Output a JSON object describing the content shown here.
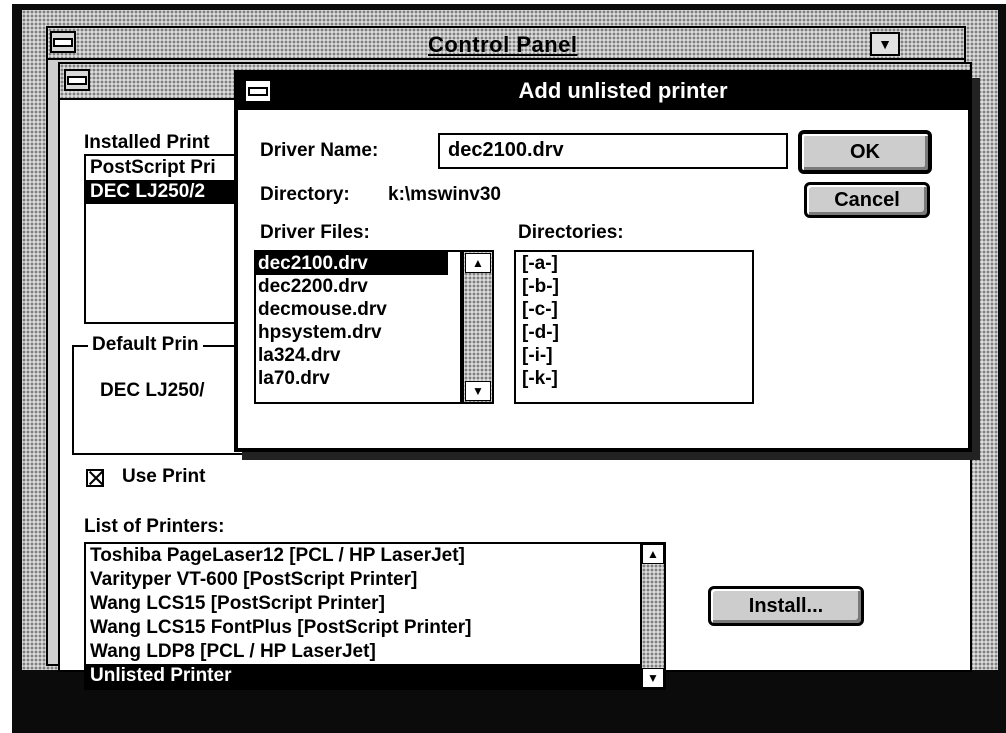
{
  "control_panel": {
    "title": "Control Panel"
  },
  "printers": {
    "installed_label": "Installed Print",
    "installed_items": [
      "PostScript Pri",
      "DEC LJ250/2"
    ],
    "default_label": "Default Prin",
    "default_value": "DEC LJ250/",
    "use_print_label": "Use Print",
    "use_print_checked": true,
    "list_label": "List of Printers:",
    "list_items": [
      "Toshiba PageLaser12 [PCL / HP LaserJet]",
      "Varityper VT-600 [PostScript Printer]",
      "Wang LCS15 [PostScript Printer]",
      "Wang LCS15 FontPlus [PostScript Printer]",
      "Wang LDP8 [PCL / HP LaserJet]",
      "Unlisted Printer"
    ],
    "install_button": "Install..."
  },
  "dialog": {
    "title": "Add unlisted printer",
    "driver_name_label": "Driver Name:",
    "driver_name_value": "dec2100.drv",
    "directory_label": "Directory:",
    "directory_value": "k:\\mswinv30",
    "driver_files_label": "Driver Files:",
    "directories_label": "Directories:",
    "driver_files": [
      "dec2100.drv",
      "dec2200.drv",
      "decmouse.drv",
      "hpsystem.drv",
      "la324.drv",
      "la70.drv"
    ],
    "directories": [
      "[-a-]",
      "[-b-]",
      "[-c-]",
      "[-d-]",
      "[-i-]",
      "[-k-]"
    ],
    "ok_button": "OK",
    "cancel_button": "Cancel"
  },
  "icons": {
    "system_menu": "system-menu-icon",
    "scroll_up": "up-arrow-icon",
    "scroll_down": "down-arrow-icon",
    "minimize": "minimize-icon"
  }
}
